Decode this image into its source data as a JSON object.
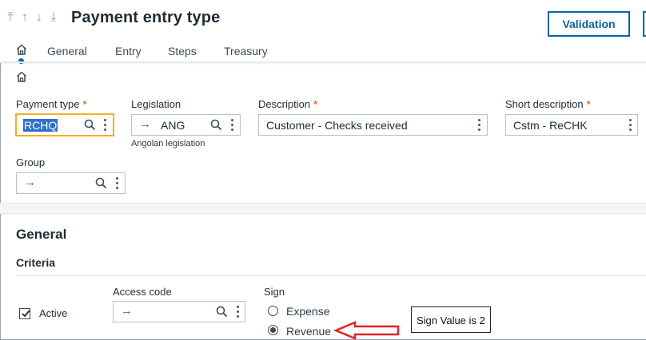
{
  "header": {
    "title": "Payment entry type",
    "validation_label": "Validation"
  },
  "tabs": [
    {
      "label": "General"
    },
    {
      "label": "Entry"
    },
    {
      "label": "Steps"
    },
    {
      "label": "Treasury"
    }
  ],
  "form": {
    "payment_type": {
      "label": "Payment type",
      "required": "*",
      "value": "RCHQ"
    },
    "legislation": {
      "label": "Legislation",
      "value": "ANG",
      "help": "Angolan legislation"
    },
    "description": {
      "label": "Description",
      "required": "*",
      "value": "Customer - Checks received"
    },
    "short_description": {
      "label": "Short description",
      "required": "*",
      "value": "Cstm - ReCHK"
    },
    "group": {
      "label": "Group",
      "value": ""
    }
  },
  "general_section": {
    "title": "General",
    "criteria": {
      "title": "Criteria",
      "active": {
        "label": "Active",
        "checked": true
      },
      "access_code": {
        "label": "Access code",
        "value": ""
      },
      "sign": {
        "label": "Sign",
        "options": [
          {
            "label": "Expense",
            "selected": false
          },
          {
            "label": "Revenue",
            "selected": true
          }
        ]
      }
    }
  },
  "annotation": {
    "text": "Sign Value is 2",
    "arrow_color": "#e32222"
  },
  "colors": {
    "accent": "#0066a1",
    "required": "#e8742a",
    "focus": "#f2b21c",
    "selection": "#2f6fd0"
  }
}
